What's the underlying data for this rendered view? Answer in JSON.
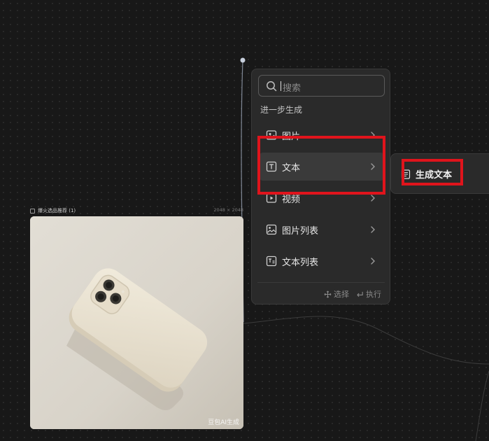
{
  "node": {
    "title": "爆火选品推荐 (1)",
    "dims": "2048 × 2048",
    "watermark": "豆包AI生成"
  },
  "menu": {
    "search_placeholder": "搜索",
    "section_label": "进一步生成",
    "items": [
      {
        "label": "图片",
        "icon": "image-icon"
      },
      {
        "label": "文本",
        "icon": "text-icon"
      },
      {
        "label": "视频",
        "icon": "video-icon"
      },
      {
        "label": "图片列表",
        "icon": "image-list-icon"
      },
      {
        "label": "文本列表",
        "icon": "text-list-icon"
      }
    ],
    "active_index": 1,
    "footer": {
      "select_label": "选择",
      "execute_label": "执行"
    }
  },
  "submenu": {
    "item_label": "生成文本",
    "icon": "document-icon"
  },
  "colors": {
    "canvas": "#181818",
    "panel": "#2a2a2a",
    "highlight": "#e0141c"
  }
}
